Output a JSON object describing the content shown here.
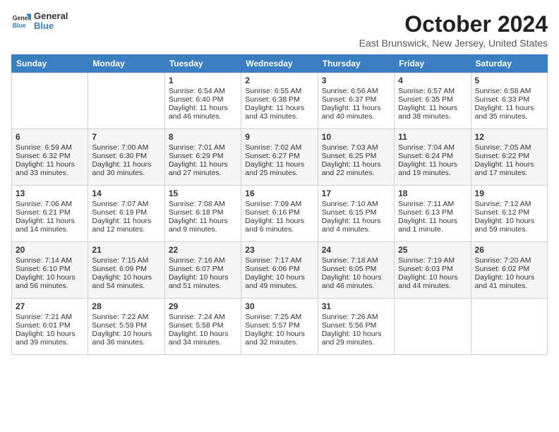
{
  "header": {
    "logo_line1": "General",
    "logo_line2": "Blue",
    "month": "October 2024",
    "location": "East Brunswick, New Jersey, United States"
  },
  "days_of_week": [
    "Sunday",
    "Monday",
    "Tuesday",
    "Wednesday",
    "Thursday",
    "Friday",
    "Saturday"
  ],
  "weeks": [
    [
      {
        "day": "",
        "info": ""
      },
      {
        "day": "",
        "info": ""
      },
      {
        "day": "1",
        "info": "Sunrise: 6:54 AM\nSunset: 6:40 PM\nDaylight: 11 hours and 46 minutes."
      },
      {
        "day": "2",
        "info": "Sunrise: 6:55 AM\nSunset: 6:38 PM\nDaylight: 11 hours and 43 minutes."
      },
      {
        "day": "3",
        "info": "Sunrise: 6:56 AM\nSunset: 6:37 PM\nDaylight: 11 hours and 40 minutes."
      },
      {
        "day": "4",
        "info": "Sunrise: 6:57 AM\nSunset: 6:35 PM\nDaylight: 11 hours and 38 minutes."
      },
      {
        "day": "5",
        "info": "Sunrise: 6:58 AM\nSunset: 6:33 PM\nDaylight: 11 hours and 35 minutes."
      }
    ],
    [
      {
        "day": "6",
        "info": "Sunrise: 6:59 AM\nSunset: 6:32 PM\nDaylight: 11 hours and 33 minutes."
      },
      {
        "day": "7",
        "info": "Sunrise: 7:00 AM\nSunset: 6:30 PM\nDaylight: 11 hours and 30 minutes."
      },
      {
        "day": "8",
        "info": "Sunrise: 7:01 AM\nSunset: 6:29 PM\nDaylight: 11 hours and 27 minutes."
      },
      {
        "day": "9",
        "info": "Sunrise: 7:02 AM\nSunset: 6:27 PM\nDaylight: 11 hours and 25 minutes."
      },
      {
        "day": "10",
        "info": "Sunrise: 7:03 AM\nSunset: 6:25 PM\nDaylight: 11 hours and 22 minutes."
      },
      {
        "day": "11",
        "info": "Sunrise: 7:04 AM\nSunset: 6:24 PM\nDaylight: 11 hours and 19 minutes."
      },
      {
        "day": "12",
        "info": "Sunrise: 7:05 AM\nSunset: 6:22 PM\nDaylight: 11 hours and 17 minutes."
      }
    ],
    [
      {
        "day": "13",
        "info": "Sunrise: 7:06 AM\nSunset: 6:21 PM\nDaylight: 11 hours and 14 minutes."
      },
      {
        "day": "14",
        "info": "Sunrise: 7:07 AM\nSunset: 6:19 PM\nDaylight: 11 hours and 12 minutes."
      },
      {
        "day": "15",
        "info": "Sunrise: 7:08 AM\nSunset: 6:18 PM\nDaylight: 11 hours and 9 minutes."
      },
      {
        "day": "16",
        "info": "Sunrise: 7:09 AM\nSunset: 6:16 PM\nDaylight: 11 hours and 6 minutes."
      },
      {
        "day": "17",
        "info": "Sunrise: 7:10 AM\nSunset: 6:15 PM\nDaylight: 11 hours and 4 minutes."
      },
      {
        "day": "18",
        "info": "Sunrise: 7:11 AM\nSunset: 6:13 PM\nDaylight: 11 hours and 1 minute."
      },
      {
        "day": "19",
        "info": "Sunrise: 7:12 AM\nSunset: 6:12 PM\nDaylight: 10 hours and 59 minutes."
      }
    ],
    [
      {
        "day": "20",
        "info": "Sunrise: 7:14 AM\nSunset: 6:10 PM\nDaylight: 10 hours and 56 minutes."
      },
      {
        "day": "21",
        "info": "Sunrise: 7:15 AM\nSunset: 6:09 PM\nDaylight: 10 hours and 54 minutes."
      },
      {
        "day": "22",
        "info": "Sunrise: 7:16 AM\nSunset: 6:07 PM\nDaylight: 10 hours and 51 minutes."
      },
      {
        "day": "23",
        "info": "Sunrise: 7:17 AM\nSunset: 6:06 PM\nDaylight: 10 hours and 49 minutes."
      },
      {
        "day": "24",
        "info": "Sunrise: 7:18 AM\nSunset: 6:05 PM\nDaylight: 10 hours and 46 minutes."
      },
      {
        "day": "25",
        "info": "Sunrise: 7:19 AM\nSunset: 6:03 PM\nDaylight: 10 hours and 44 minutes."
      },
      {
        "day": "26",
        "info": "Sunrise: 7:20 AM\nSunset: 6:02 PM\nDaylight: 10 hours and 41 minutes."
      }
    ],
    [
      {
        "day": "27",
        "info": "Sunrise: 7:21 AM\nSunset: 6:01 PM\nDaylight: 10 hours and 39 minutes."
      },
      {
        "day": "28",
        "info": "Sunrise: 7:22 AM\nSunset: 5:59 PM\nDaylight: 10 hours and 36 minutes."
      },
      {
        "day": "29",
        "info": "Sunrise: 7:24 AM\nSunset: 5:58 PM\nDaylight: 10 hours and 34 minutes."
      },
      {
        "day": "30",
        "info": "Sunrise: 7:25 AM\nSunset: 5:57 PM\nDaylight: 10 hours and 32 minutes."
      },
      {
        "day": "31",
        "info": "Sunrise: 7:26 AM\nSunset: 5:56 PM\nDaylight: 10 hours and 29 minutes."
      },
      {
        "day": "",
        "info": ""
      },
      {
        "day": "",
        "info": ""
      }
    ]
  ]
}
